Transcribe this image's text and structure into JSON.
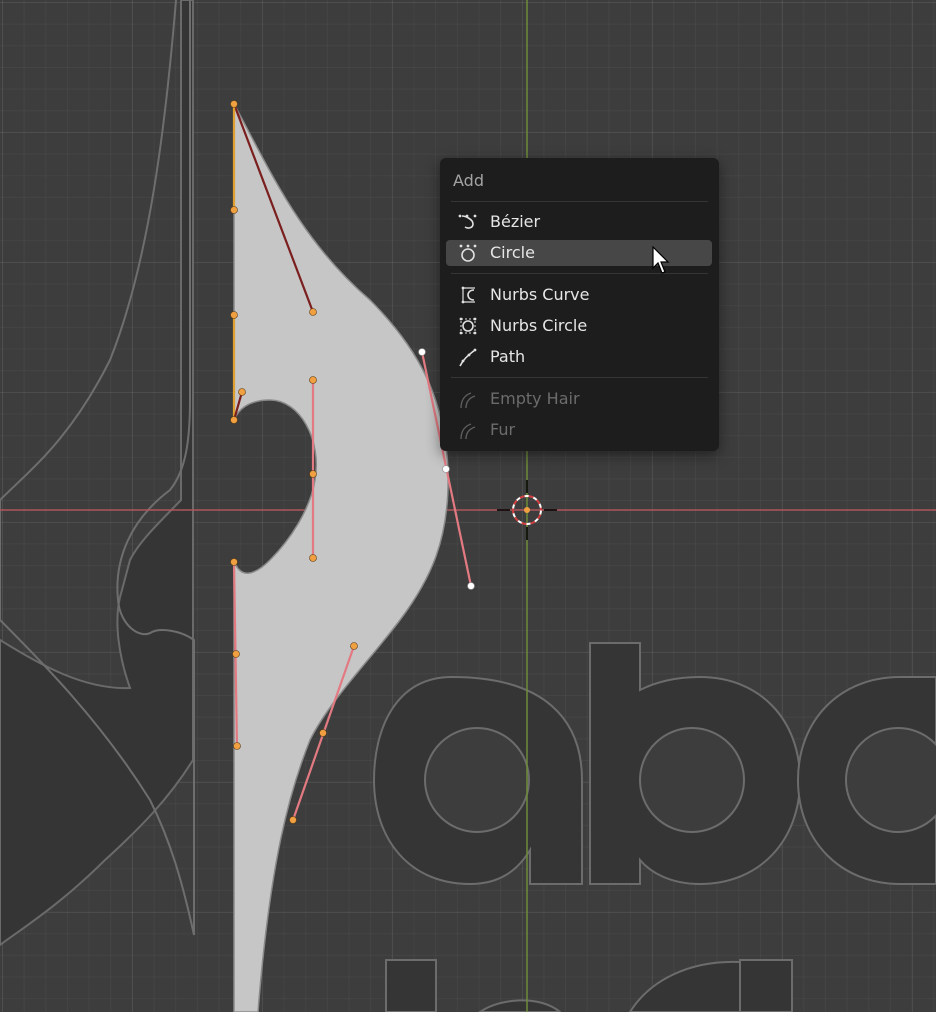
{
  "app": "Blender",
  "view": "3D Viewport - Curve Edit Mode",
  "menu": {
    "title": "Add",
    "items": [
      {
        "label": "Bézier",
        "icon": "bezier-curve-icon",
        "state": "normal"
      },
      {
        "label": "Circle",
        "icon": "bezier-circle-icon",
        "state": "highlighted"
      },
      {
        "label": "Nurbs Curve",
        "icon": "nurbs-curve-icon",
        "state": "normal"
      },
      {
        "label": "Nurbs Circle",
        "icon": "nurbs-circle-icon",
        "state": "normal"
      },
      {
        "label": "Path",
        "icon": "path-curve-icon",
        "state": "normal"
      },
      {
        "label": "Empty Hair",
        "icon": "hair-icon",
        "state": "disabled"
      },
      {
        "label": "Fur",
        "icon": "fur-icon",
        "state": "disabled"
      }
    ]
  },
  "colors": {
    "viewport_bg": "#3d3d3d",
    "menu_bg": "#1d1d1d",
    "menu_highlight": "#474747",
    "menu_text": "#e6e6e6",
    "menu_text_disabled": "#6c6c6c",
    "axis_x": "#b0565d",
    "axis_y": "#6e8c3a",
    "shape_fill": "#c6c6c6",
    "control_point": "#f0a040",
    "handle_line": "#e37a82"
  }
}
